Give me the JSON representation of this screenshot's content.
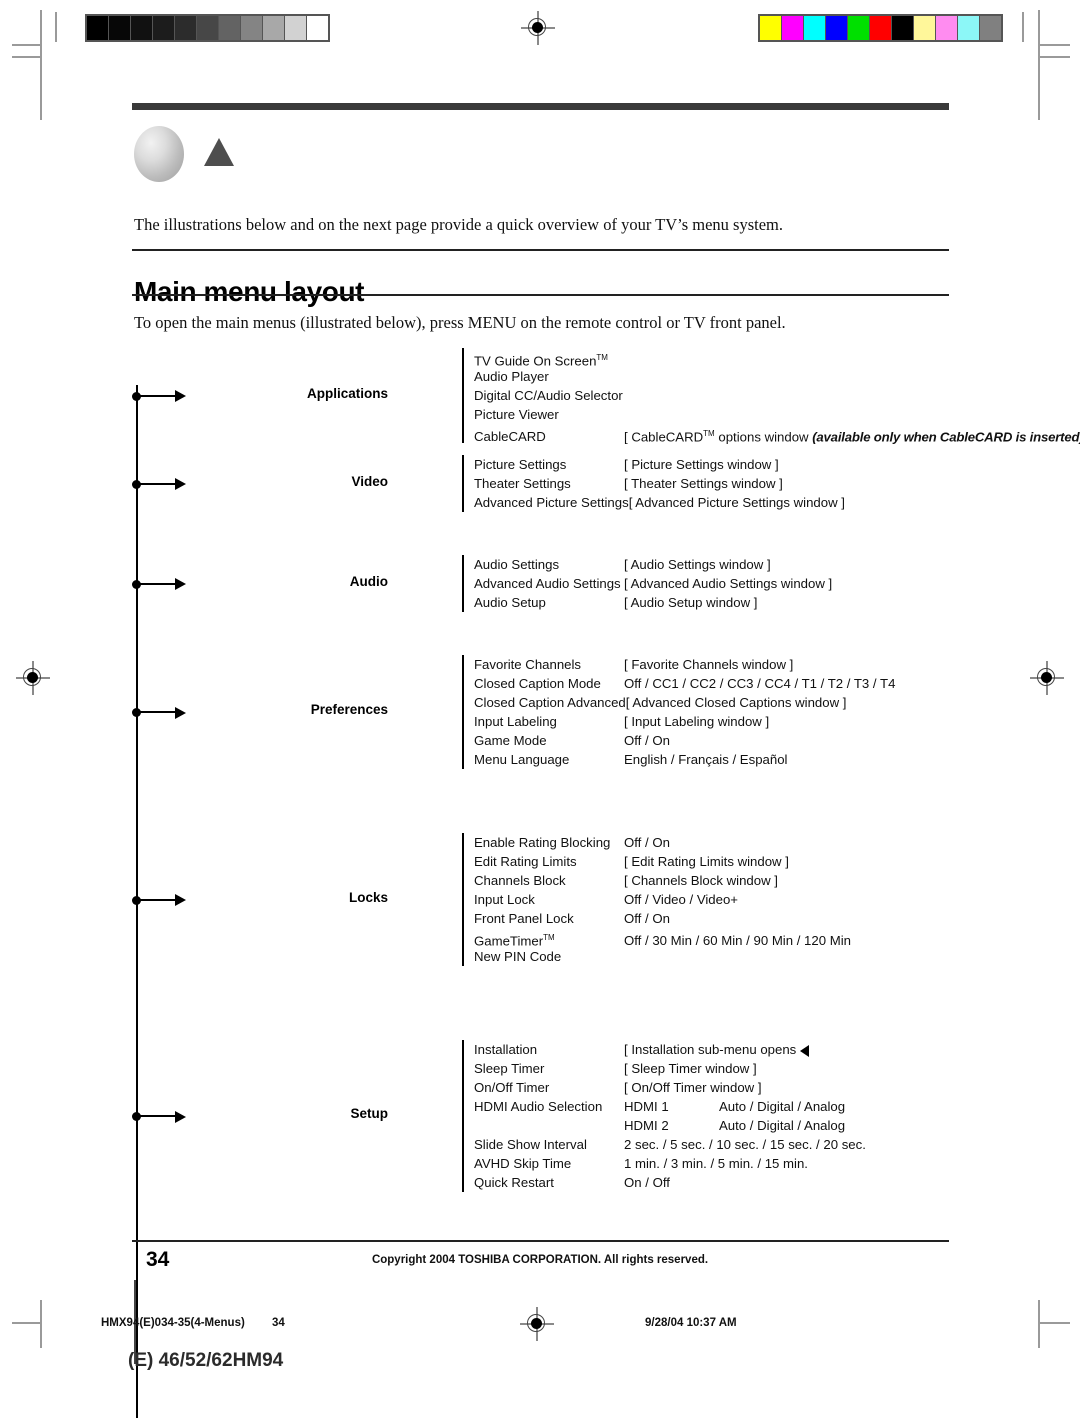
{
  "document": {
    "heading": "Main menu layout",
    "intro": "The illustrations below and on the next page provide a quick overview of your TV’s menu system.",
    "subintro": "To open the main menus (illustrated below), press MENU on the remote control or TV front panel.",
    "page_number": "34",
    "copyright": "Copyright  2004 TOSHIBA CORPORATION. All rights reserved."
  },
  "print_marks": {
    "gray_wedge": [
      "#000000",
      "#070707",
      "#111111",
      "#1c1c1c",
      "#2c2c2c",
      "#474747",
      "#636363",
      "#848484",
      "#a8a8a8",
      "#d2d2d2",
      "#ffffff"
    ],
    "color_bars": [
      "#ffff00",
      "#ff00ff",
      "#00ffff",
      "#0000ff",
      "#00e000",
      "#ff0000",
      "#000000",
      "#fff79a",
      "#ff8cf0",
      "#8cf7f7",
      "#808080"
    ]
  },
  "footer_meta": {
    "job": "HMX94(E)034-35(4-Menus)",
    "page": "34",
    "date": "9/28/04  10:37 AM",
    "model": "(E) 46/52/62HM94"
  },
  "menu_tree": {
    "branches": [
      {
        "title": "Applications",
        "items": [
          {
            "label": "TV Guide On Screen",
            "tm": true,
            "value": ""
          },
          {
            "label": "Audio Player",
            "value": ""
          },
          {
            "label": "Digital CC/Audio Selector",
            "value": ""
          },
          {
            "label": "Picture Viewer",
            "value": ""
          },
          {
            "label": "CableCARD",
            "value": "[ CableCARD",
            "value_tm": true,
            "value_rest": " options  window ",
            "note": "(available only when CableCARD is inserted)",
            "value_tail": " ]"
          }
        ]
      },
      {
        "title": "Video",
        "items": [
          {
            "label": "Picture Settings",
            "value": "[ Picture Settings window ]"
          },
          {
            "label": "Theater Settings",
            "value": "[ Theater Settings window ]"
          },
          {
            "label": "Advanced Picture Settings",
            "value": "[ Advanced Picture Settings window ]"
          }
        ]
      },
      {
        "title": "Audio",
        "items": [
          {
            "label": "Audio Settings",
            "value": "[ Audio Settings window ]"
          },
          {
            "label": "Advanced Audio Settings",
            "value": "[ Advanced Audio Settings window ]"
          },
          {
            "label": "Audio Setup",
            "value": "[ Audio Setup window ]"
          }
        ]
      },
      {
        "title": "Preferences",
        "items": [
          {
            "label": "Favorite Channels",
            "value": "[ Favorite Channels window ]"
          },
          {
            "label": "Closed Caption Mode",
            "value": "Off / CC1 / CC2 / CC3 / CC4 / T1 / T2 / T3 / T4"
          },
          {
            "label": "Closed Caption Advanced",
            "value": "[ Advanced Closed Captions window ]"
          },
          {
            "label": "Input Labeling",
            "value": "[ Input Labeling window ]"
          },
          {
            "label": "Game Mode",
            "value": "Off / On"
          },
          {
            "label": "Menu Language",
            "value": "English / Français / Español"
          }
        ]
      },
      {
        "title": "Locks",
        "items": [
          {
            "label": "Enable Rating Blocking",
            "value": "Off / On"
          },
          {
            "label": "Edit Rating Limits",
            "value": "[ Edit Rating Limits window ]"
          },
          {
            "label": "Channels Block",
            "value": "[ Channels Block window ]"
          },
          {
            "label": "Input Lock",
            "value": "Off / Video / Video+"
          },
          {
            "label": "Front Panel Lock",
            "value": "Off / On"
          },
          {
            "label": "GameTimer",
            "tm": true,
            "value": "Off / 30 Min / 60 Min / 90 Min / 120 Min"
          },
          {
            "label": "New PIN Code",
            "value": ""
          }
        ]
      },
      {
        "title": "Setup",
        "items": [
          {
            "label": "Installation",
            "value": "[ Installation sub-menu opens",
            "caret": true,
            "dash": true,
            "value_tail": "]"
          },
          {
            "label": "Sleep Timer",
            "value": "[ Sleep Timer window ]"
          },
          {
            "label": "On/Off Timer",
            "value": "[ On/Off Timer window ]"
          },
          {
            "label": "HDMI Audio Selection",
            "value": "HDMI 1",
            "value2": "Auto / Digital / Analog"
          },
          {
            "label": "",
            "value": "HDMI 2",
            "value2": "Auto / Digital / Analog"
          },
          {
            "label": "Slide Show Interval",
            "value": "2 sec. / 5 sec. / 10 sec. / 15 sec. / 20 sec."
          },
          {
            "label": "AVHD Skip Time",
            "value": "1 min. / 3 min. / 5 min. / 15 min."
          },
          {
            "label": "Quick Restart",
            "value": "On / Off"
          }
        ]
      }
    ]
  }
}
